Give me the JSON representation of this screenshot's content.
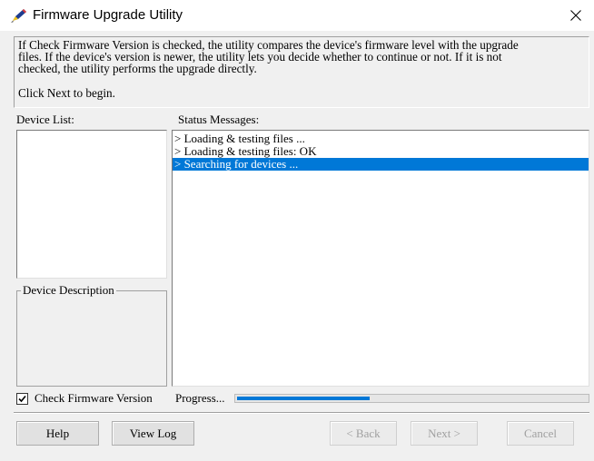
{
  "window": {
    "title": "Firmware Upgrade Utility",
    "app_icon": "pencil-icon",
    "close_icon": "close-icon"
  },
  "description": {
    "lines": [
      "If Check Firmware Version is checked, the utility compares the device's firmware level with the upgrade",
      "files. If the device's version is newer, the utility lets you decide whether to continue or not. If it is not",
      "checked, the utility performs the upgrade directly."
    ],
    "begin": "Click Next to begin."
  },
  "device_list": {
    "label": "Device List:"
  },
  "status": {
    "label": "Status Messages:",
    "messages": [
      "> Loading & testing files ...",
      "> Loading & testing files: OK",
      "> Searching for devices ..."
    ],
    "selected_index": 2
  },
  "device_description": {
    "label": "Device Description"
  },
  "check_firmware": {
    "label": "Check Firmware Version",
    "checked": true
  },
  "progress": {
    "label": "Progress...",
    "value": 0.38
  },
  "buttons": {
    "help": "Help",
    "view_log": "View Log",
    "back": "< Back",
    "next": "Next >",
    "cancel": "Cancel"
  },
  "colors": {
    "accent": "#0078d7",
    "background": "#f0f0f0"
  }
}
